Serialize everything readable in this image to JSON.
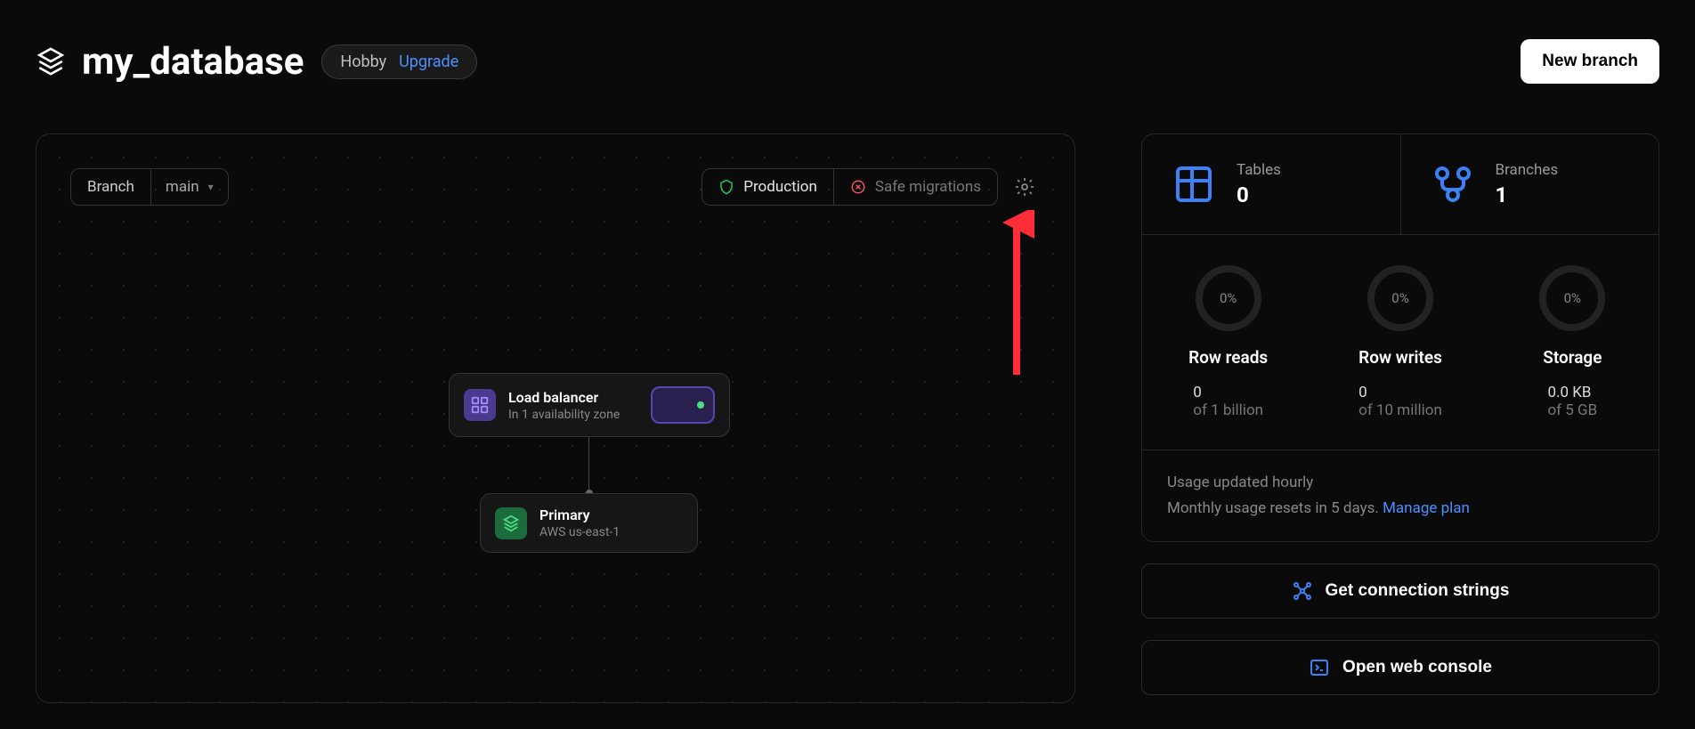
{
  "header": {
    "database_name": "my_database",
    "tier_name": "Hobby",
    "upgrade_label": "Upgrade",
    "new_branch_label": "New branch"
  },
  "canvas": {
    "branch_label": "Branch",
    "branch_value": "main",
    "production_label": "Production",
    "safe_migrations_label": "Safe migrations",
    "load_balancer": {
      "title": "Load balancer",
      "subtitle": "In 1 availability zone"
    },
    "primary": {
      "title": "Primary",
      "subtitle": "AWS us-east-1"
    }
  },
  "stats": {
    "tables": {
      "label": "Tables",
      "value": "0"
    },
    "branches": {
      "label": "Branches",
      "value": "1"
    },
    "row_reads": {
      "percent": "0%",
      "title": "Row reads",
      "value": "0",
      "limit": "of 1 billion"
    },
    "row_writes": {
      "percent": "0%",
      "title": "Row writes",
      "value": "0",
      "limit": "of 10 million"
    },
    "storage": {
      "percent": "0%",
      "title": "Storage",
      "value": "0.0 KB",
      "limit": "of 5 GB"
    },
    "usage_updated": "Usage updated hourly",
    "monthly_reset": "Monthly usage resets in 5 days. ",
    "manage_plan_label": "Manage plan"
  },
  "actions": {
    "connection_strings": "Get connection strings",
    "web_console": "Open web console"
  },
  "colors": {
    "accent_blue": "#4a8fff",
    "icon_blue": "#3b82f6",
    "shield_green": "#22c55e",
    "x_red": "#ef5563"
  }
}
